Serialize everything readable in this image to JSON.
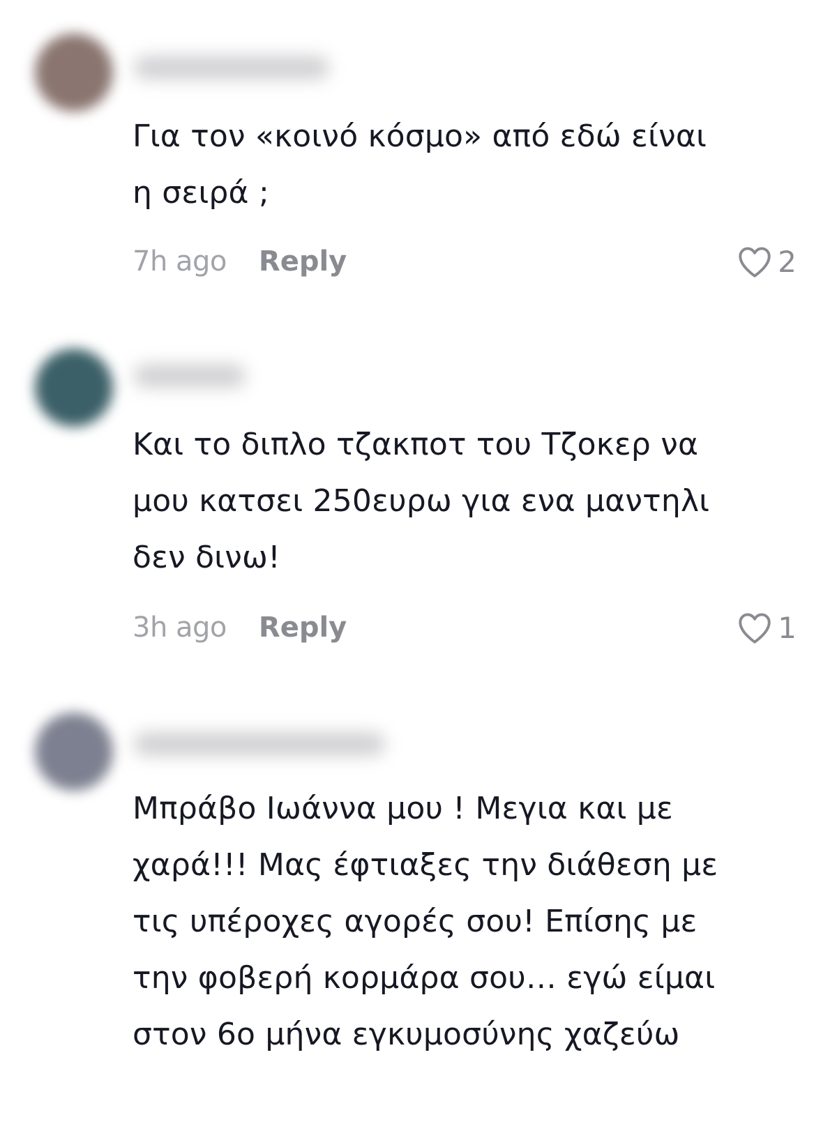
{
  "comments": [
    {
      "text": "Για τον «κοινό κόσμο» από εδώ είναι\nη σειρά ;",
      "time": "7h ago",
      "reply_label": "Reply",
      "likes": "2",
      "avatar_color": "#8a7570"
    },
    {
      "text": "Και το διπλο τζακποτ του Τζοκερ να\nμου κατσει 250ευρω για ενα μαντηλι\nδεν δινω!",
      "time": "3h ago",
      "reply_label": "Reply",
      "likes": "1",
      "avatar_color": "#3c6068"
    },
    {
      "text": "Μπράβο Ιωάννα μου ! Μεγια και με\nχαρά!!! Μας έφτιαξες την διάθεση με\nτις υπέροχες αγορές σου! Επίσης με\nτην φοβερή κορμάρα σου… εγώ είμαι\nστον 6ο μήνα εγκυμοσύνης χαζεύω",
      "avatar_color": "#7d8090"
    }
  ],
  "icons": {
    "like": "heart-outline-icon"
  }
}
